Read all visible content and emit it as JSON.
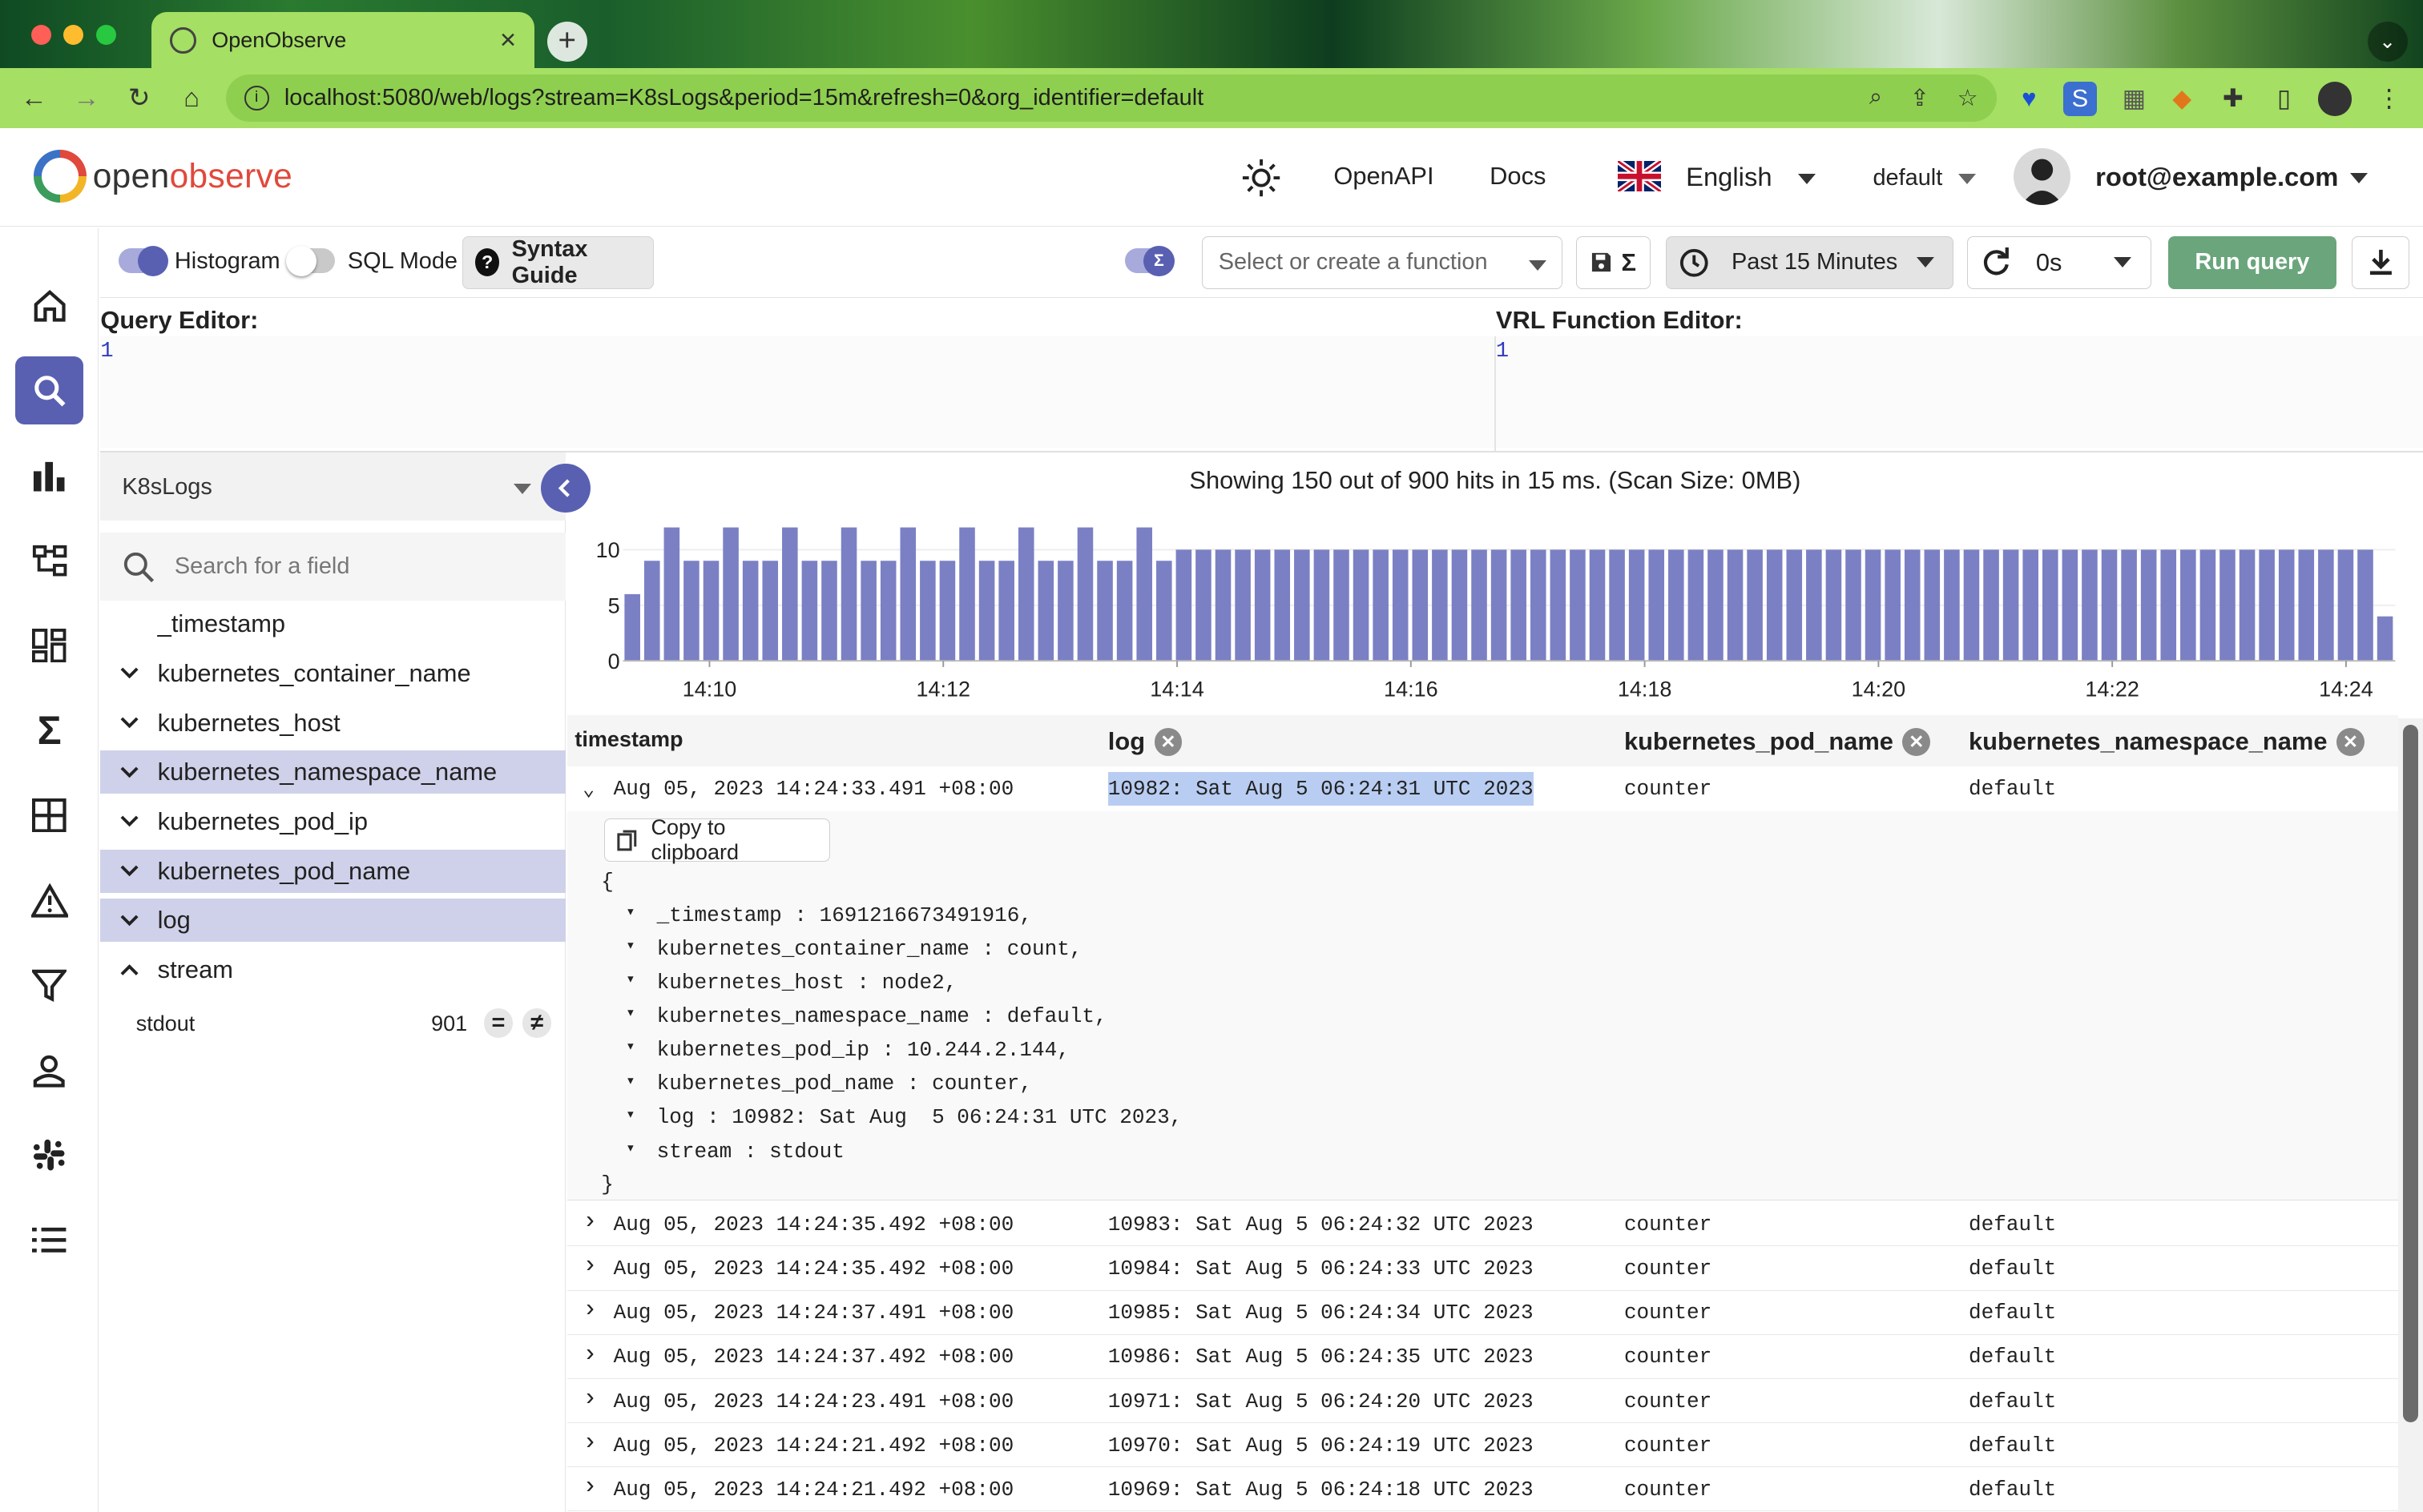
{
  "browser": {
    "tab_title": "OpenObserve",
    "url": "localhost:5080/web/logs?stream=K8sLogs&period=15m&refresh=0&org_identifier=default"
  },
  "header": {
    "logo_prefix": "open",
    "logo_suffix": "observe",
    "openapi": "OpenAPI",
    "docs": "Docs",
    "language": "English",
    "org": "default",
    "user": "root@example.com"
  },
  "toolbar": {
    "histogram_label": "Histogram",
    "sql_mode_label": "SQL Mode",
    "syntax_guide": "Syntax Guide",
    "function_placeholder": "Select or create a function",
    "time_range": "Past 15 Minutes",
    "refresh": "0s",
    "run_query": "Run query"
  },
  "editors": {
    "query_title": "Query Editor:",
    "query_line": "1",
    "vrl_title": "VRL Function Editor:",
    "vrl_line": "1"
  },
  "sidebar": {
    "stream": "K8sLogs",
    "search_placeholder": "Search for a field",
    "fields": [
      {
        "name": "_timestamp",
        "selected": false,
        "expand": "none"
      },
      {
        "name": "kubernetes_container_name",
        "selected": false,
        "expand": "down"
      },
      {
        "name": "kubernetes_host",
        "selected": false,
        "expand": "down"
      },
      {
        "name": "kubernetes_namespace_name",
        "selected": true,
        "expand": "down"
      },
      {
        "name": "kubernetes_pod_ip",
        "selected": false,
        "expand": "down"
      },
      {
        "name": "kubernetes_pod_name",
        "selected": true,
        "expand": "down"
      },
      {
        "name": "log",
        "selected": true,
        "expand": "down"
      },
      {
        "name": "stream",
        "selected": false,
        "expand": "up"
      }
    ],
    "value": {
      "name": "stdout",
      "count": "901"
    }
  },
  "results": {
    "hits_text": "Showing 150 out of 900 hits in 15 ms. (Scan Size: 0MB)",
    "columns": [
      "timestamp",
      "log",
      "kubernetes_pod_name",
      "kubernetes_namespace_name"
    ],
    "copy_label": "Copy to clipboard",
    "expanded_row": {
      "timestamp": "Aug 05, 2023 14:24:33.491 +08:00",
      "log": "10982: Sat Aug 5 06:24:31 UTC 2023",
      "pod": "counter",
      "namespace": "default"
    },
    "json_open": "{",
    "json_close": "}",
    "json_lines": [
      "_timestamp : 1691216673491916,",
      "kubernetes_container_name : count,",
      "kubernetes_host : node2,",
      "kubernetes_namespace_name : default,",
      "kubernetes_pod_ip : 10.244.2.144,",
      "kubernetes_pod_name : counter,",
      "log : 10982: Sat Aug  5 06:24:31 UTC 2023,",
      "stream : stdout"
    ],
    "rows": [
      {
        "timestamp": "Aug 05, 2023 14:24:35.492 +08:00",
        "log": "10983: Sat Aug 5 06:24:32 UTC 2023",
        "pod": "counter",
        "namespace": "default"
      },
      {
        "timestamp": "Aug 05, 2023 14:24:35.492 +08:00",
        "log": "10984: Sat Aug 5 06:24:33 UTC 2023",
        "pod": "counter",
        "namespace": "default"
      },
      {
        "timestamp": "Aug 05, 2023 14:24:37.491 +08:00",
        "log": "10985: Sat Aug 5 06:24:34 UTC 2023",
        "pod": "counter",
        "namespace": "default"
      },
      {
        "timestamp": "Aug 05, 2023 14:24:37.492 +08:00",
        "log": "10986: Sat Aug 5 06:24:35 UTC 2023",
        "pod": "counter",
        "namespace": "default"
      },
      {
        "timestamp": "Aug 05, 2023 14:24:23.491 +08:00",
        "log": "10971: Sat Aug 5 06:24:20 UTC 2023",
        "pod": "counter",
        "namespace": "default"
      },
      {
        "timestamp": "Aug 05, 2023 14:24:21.492 +08:00",
        "log": "10970: Sat Aug 5 06:24:19 UTC 2023",
        "pod": "counter",
        "namespace": "default"
      },
      {
        "timestamp": "Aug 05, 2023 14:24:21.492 +08:00",
        "log": "10969: Sat Aug 5 06:24:18 UTC 2023",
        "pod": "counter",
        "namespace": "default"
      }
    ]
  },
  "colors": {
    "accent": "#5960b2",
    "run": "#6aa57c",
    "selected_field": "#cfd1ea",
    "bar": "#7b80c4"
  },
  "chart_data": {
    "type": "bar",
    "x_ticks": [
      "14:10",
      "14:12",
      "14:14",
      "14:16",
      "14:18",
      "14:20",
      "14:22",
      "14:24"
    ],
    "y_ticks": [
      "0",
      "5",
      "10"
    ],
    "ylim": [
      0,
      12
    ],
    "values": [
      6,
      9,
      12,
      9,
      9,
      12,
      9,
      9,
      12,
      9,
      9,
      12,
      9,
      9,
      12,
      9,
      9,
      12,
      9,
      9,
      12,
      9,
      9,
      12,
      9,
      9,
      12,
      9,
      10,
      10,
      10,
      10,
      10,
      10,
      10,
      10,
      10,
      10,
      10,
      10,
      10,
      10,
      10,
      10,
      10,
      10,
      10,
      10,
      10,
      10,
      10,
      10,
      10,
      10,
      10,
      10,
      10,
      10,
      10,
      10,
      10,
      10,
      10,
      10,
      10,
      10,
      10,
      10,
      10,
      10,
      10,
      10,
      10,
      10,
      10,
      10,
      10,
      10,
      10,
      10,
      10,
      10,
      10,
      10,
      10,
      10,
      10,
      10,
      10,
      4
    ]
  }
}
